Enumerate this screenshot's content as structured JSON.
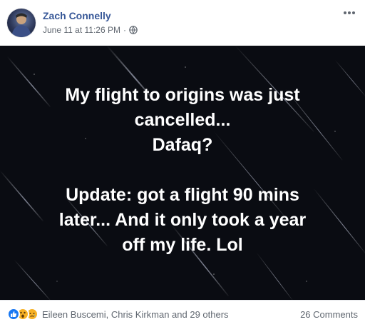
{
  "post": {
    "author": "Zach Connelly",
    "date": "June 11 at 11:26 PM",
    "separator": "·",
    "privacy_icon": "globe-icon",
    "more_icon": "more-options-icon",
    "lines": [
      "My flight to origins was just",
      "cancelled...",
      "Dafaq?",
      "",
      "Update: got a flight 90 mins",
      "later... And it only took a year",
      "off my life. Lol"
    ],
    "image_background": "#0a0c12",
    "text_color": "#ffffff"
  },
  "footer": {
    "reaction_icons": [
      "like-icon",
      "wow-icon",
      "sad-icon"
    ],
    "reaction_names": "Eileen Buscemi, Chris Kirkman and 29 others",
    "comments": "26 Comments"
  },
  "colors": {
    "author_link": "#385898",
    "meta_text": "#606770",
    "like_blue": "#1877f2",
    "emoji_yellow": "#f7b125"
  }
}
